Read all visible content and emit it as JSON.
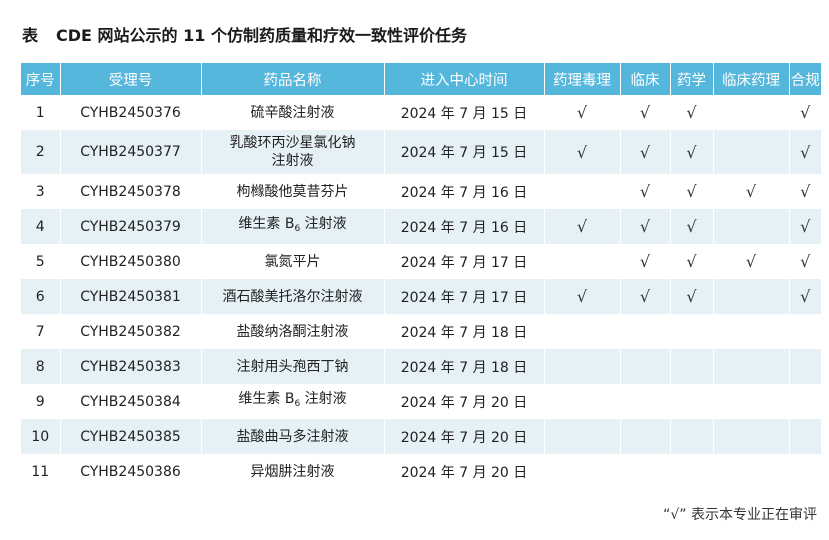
{
  "caption": {
    "label": "表",
    "text": "CDE 网站公示的 11 个仿制药质量和疗效一致性评价任务"
  },
  "headers": [
    "序号",
    "受理号",
    "药品名称",
    "进入中心时间",
    "药理毒理",
    "临床",
    "药学",
    "临床药理",
    "合规"
  ],
  "check_symbol": "√",
  "rows": [
    {
      "no": "1",
      "id": "CYHB2450376",
      "name": "硫辛酸注射液",
      "date": "2024 年 7 月 15 日",
      "checks": [
        true,
        true,
        true,
        false,
        true
      ]
    },
    {
      "no": "2",
      "id": "CYHB2450377",
      "name_line1": "乳酸环丙沙星氯化钠",
      "name_line2": "注射液",
      "date": "2024 年 7 月 15 日",
      "checks": [
        true,
        true,
        true,
        false,
        true
      ]
    },
    {
      "no": "3",
      "id": "CYHB2450378",
      "name": "枸橼酸他莫昔芬片",
      "date": "2024 年 7 月 16 日",
      "checks": [
        false,
        true,
        true,
        true,
        true
      ]
    },
    {
      "no": "4",
      "id": "CYHB2450379",
      "name_pre": "维生素 B",
      "name_sub": "6",
      "name_post": " 注射液",
      "date": "2024 年 7 月 16 日",
      "checks": [
        true,
        true,
        true,
        false,
        true
      ]
    },
    {
      "no": "5",
      "id": "CYHB2450380",
      "name": "氯氮平片",
      "date": "2024 年 7 月 17 日",
      "checks": [
        false,
        true,
        true,
        true,
        true
      ]
    },
    {
      "no": "6",
      "id": "CYHB2450381",
      "name": "酒石酸美托洛尔注射液",
      "date": "2024 年 7 月 17 日",
      "checks": [
        true,
        true,
        true,
        false,
        true
      ]
    },
    {
      "no": "7",
      "id": "CYHB2450382",
      "name": "盐酸纳洛酮注射液",
      "date": "2024 年 7 月 18 日",
      "checks": [
        false,
        false,
        false,
        false,
        false
      ]
    },
    {
      "no": "8",
      "id": "CYHB2450383",
      "name": "注射用头孢西丁钠",
      "date": "2024 年 7 月 18 日",
      "checks": [
        false,
        false,
        false,
        false,
        false
      ]
    },
    {
      "no": "9",
      "id": "CYHB2450384",
      "name_pre": "维生素 B",
      "name_sub": "6",
      "name_post": " 注射液",
      "date": "2024 年 7 月 20 日",
      "checks": [
        false,
        false,
        false,
        false,
        false
      ]
    },
    {
      "no": "10",
      "id": "CYHB2450385",
      "name": "盐酸曲马多注射液",
      "date": "2024 年 7 月 20 日",
      "checks": [
        false,
        false,
        false,
        false,
        false
      ]
    },
    {
      "no": "11",
      "id": "CYHB2450386",
      "name": "异烟肼注射液",
      "date": "2024 年 7 月 20 日",
      "checks": [
        false,
        false,
        false,
        false,
        false
      ]
    }
  ],
  "note": "“√” 表示本专业正在审评",
  "colors": {
    "header_bg": "#55b7dc",
    "header_text": "#ffffff",
    "stripe": "#e6f1f6"
  }
}
